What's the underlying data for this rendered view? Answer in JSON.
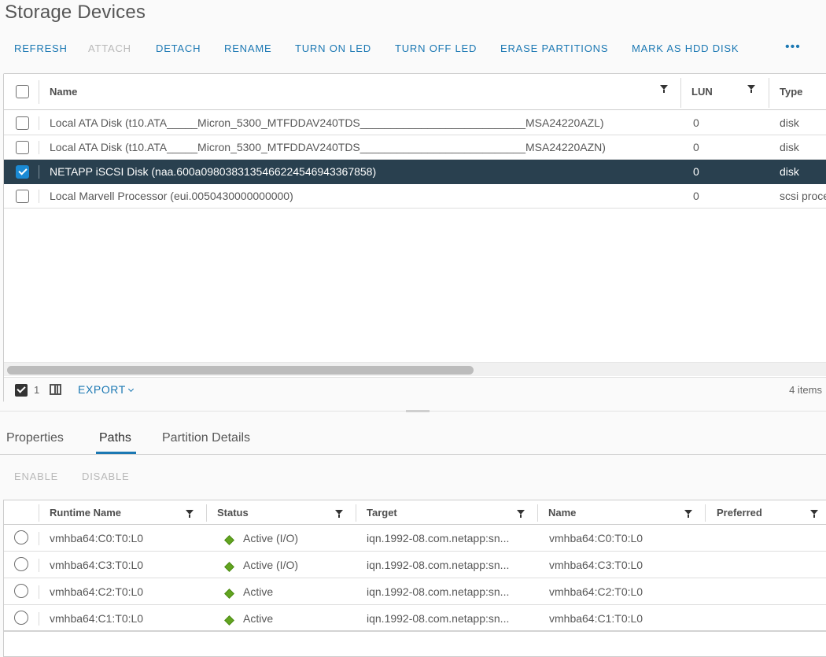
{
  "page": {
    "title": "Storage Devices"
  },
  "toolbar": {
    "buttons": [
      {
        "label": "REFRESH",
        "enabled": true
      },
      {
        "label": "ATTACH",
        "enabled": false
      },
      {
        "label": "DETACH",
        "enabled": true
      },
      {
        "label": "RENAME",
        "enabled": true
      },
      {
        "label": "TURN ON LED",
        "enabled": true
      },
      {
        "label": "TURN OFF LED",
        "enabled": true
      },
      {
        "label": "ERASE PARTITIONS",
        "enabled": true
      },
      {
        "label": "MARK AS HDD DISK",
        "enabled": true
      }
    ],
    "more_label": "•••"
  },
  "devices_grid": {
    "columns": {
      "name": "Name",
      "lun": "LUN",
      "type": "Type"
    },
    "rows": [
      {
        "name": "Local ATA Disk (t10.ATA_____Micron_5300_MTFDDAV240TDS___________________________MSA24220AZL)",
        "lun": "0",
        "type": "disk",
        "selected": false
      },
      {
        "name": "Local ATA Disk (t10.ATA_____Micron_5300_MTFDDAV240TDS___________________________MSA24220AZN)",
        "lun": "0",
        "type": "disk",
        "selected": false
      },
      {
        "name": "NETAPP iSCSI Disk (naa.600a098038313546622454694336785​8)",
        "lun": "0",
        "type": "disk",
        "selected": true
      },
      {
        "name": "Local Marvell Processor (eui.0050430000000000)",
        "lun": "0",
        "type": "scsi processor",
        "selected": false
      }
    ],
    "footer": {
      "selected_count": "1",
      "export_label": "EXPORT",
      "items_label": "4 items"
    }
  },
  "detail_tabs": [
    {
      "label": "Properties",
      "active": false
    },
    {
      "label": "Paths",
      "active": true
    },
    {
      "label": "Partition Details",
      "active": false
    }
  ],
  "paths_toolbar": {
    "enable_label": "ENABLE",
    "disable_label": "DISABLE"
  },
  "paths_grid": {
    "columns": {
      "runtime_name": "Runtime Name",
      "status": "Status",
      "target": "Target",
      "name": "Name",
      "preferred": "Preferred"
    },
    "rows": [
      {
        "runtime_name": "vmhba64:C0:T0:L0",
        "status": "Active (I/O)",
        "target": "iqn.1992-08.com.netapp:sn...",
        "name": "vmhba64:C0:T0:L0",
        "preferred": ""
      },
      {
        "runtime_name": "vmhba64:C3:T0:L0",
        "status": "Active (I/O)",
        "target": "iqn.1992-08.com.netapp:sn...",
        "name": "vmhba64:C3:T0:L0",
        "preferred": ""
      },
      {
        "runtime_name": "vmhba64:C2:T0:L0",
        "status": "Active",
        "target": "iqn.1992-08.com.netapp:sn...",
        "name": "vmhba64:C2:T0:L0",
        "preferred": ""
      },
      {
        "runtime_name": "vmhba64:C1:T0:L0",
        "status": "Active",
        "target": "iqn.1992-08.com.netapp:sn...",
        "name": "vmhba64:C1:T0:L0",
        "preferred": ""
      }
    ]
  },
  "colors": {
    "accent": "#1b78b3",
    "selected_row": "#29404f",
    "status_active": "#62a420",
    "checkbox_checked": "#1a8ad4"
  }
}
